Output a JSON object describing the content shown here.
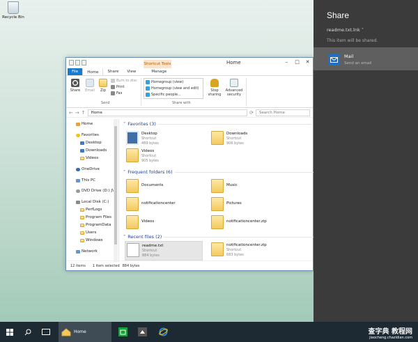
{
  "desktop": {
    "recycle_bin_label": "Recycle Bin"
  },
  "explorer": {
    "title": "Home",
    "contextual_tab": "Shortcut Tools",
    "window_controls": [
      "–",
      "□",
      "✕"
    ],
    "tabs": [
      "File",
      "Home",
      "Share",
      "View",
      "Manage"
    ],
    "ribbon": {
      "send": {
        "share": "Share",
        "email": "Email",
        "zip": "Zip",
        "burn": "Burn to disc",
        "print": "Print",
        "fax": "Fax",
        "group_label": "Send"
      },
      "share_with": {
        "homegroup_view": "Homegroup (view)",
        "homegroup_view_edit": "Homegroup (view and edit)",
        "specific_people": "Specific people...",
        "stop_sharing": "Stop sharing",
        "advanced_security": "Advanced security",
        "group_label": "Share with"
      }
    },
    "address": {
      "path": "Home",
      "search_placeholder": "Search Home"
    },
    "nav_items": [
      "Home",
      "Favorites",
      "Desktop",
      "Downloads",
      "Videos",
      "OneDrive",
      "This PC",
      "DVD Drive (D:) JV",
      "Local Disk (C:)",
      "PerfLogs",
      "Program Files",
      "ProgramData",
      "Users",
      "Windows",
      "Network"
    ],
    "favorites": {
      "header": "Favorites (3)",
      "items": [
        {
          "name": "Desktop",
          "type": "Shortcut",
          "size": "489 bytes"
        },
        {
          "name": "Downloads",
          "type": "Shortcut",
          "size": "906 bytes"
        },
        {
          "name": "Videos",
          "type": "Shortcut",
          "size": "905 bytes"
        }
      ]
    },
    "frequent": {
      "header": "Frequent folders (6)",
      "items": [
        "Documents",
        "Music",
        "notificationcenter",
        "Pictures",
        "Videos",
        "notificationcenter.zip"
      ]
    },
    "recent": {
      "header": "Recent files (2)",
      "items": [
        {
          "name": "readme.txt",
          "type": "Shortcut",
          "size": "884 bytes"
        },
        {
          "name": "notificationcenter.zip",
          "type": "Shortcut",
          "size": "683 bytes"
        }
      ]
    },
    "status": {
      "count": "12 items",
      "selection": "1 item selected",
      "size": "884 bytes"
    }
  },
  "share_charm": {
    "title": "Share",
    "file": "readme.txt.lnk ˅",
    "note": "This item will be shared.",
    "app_name": "Mail",
    "app_desc": "Send an email"
  },
  "taskbar": {
    "explorer_label": "Home"
  },
  "watermark": {
    "line1": "查字典 教程网",
    "line2": "jiaocheng.chazidian.com"
  },
  "colors": {
    "accent": "#1979ca",
    "share_bg": "#3b3b3b",
    "mail_tile": "#1f6fc4",
    "taskbar": "#1d2933"
  }
}
